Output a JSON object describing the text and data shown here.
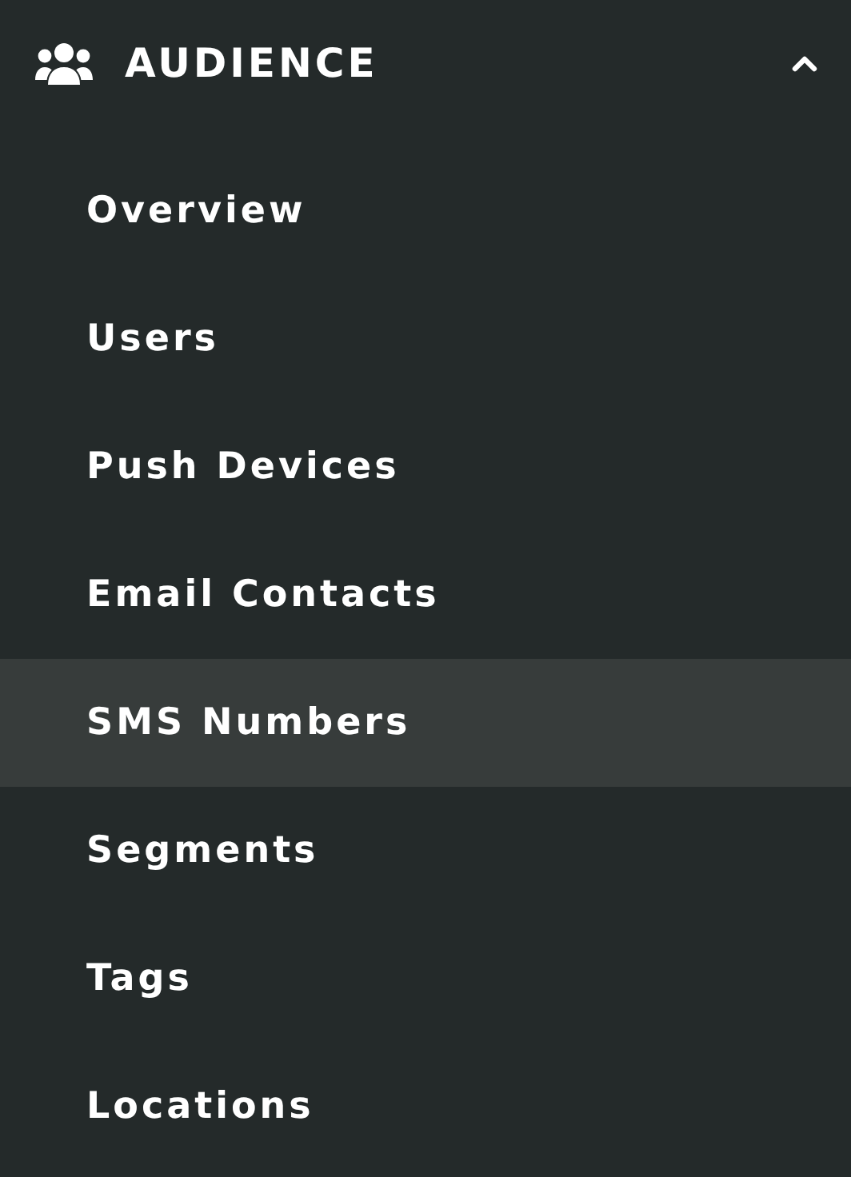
{
  "section": {
    "title": "AUDIENCE",
    "expanded": true
  },
  "items": [
    {
      "label": "Overview",
      "selected": false
    },
    {
      "label": "Users",
      "selected": false
    },
    {
      "label": "Push Devices",
      "selected": false
    },
    {
      "label": "Email Contacts",
      "selected": false
    },
    {
      "label": "SMS Numbers",
      "selected": true
    },
    {
      "label": "Segments",
      "selected": false
    },
    {
      "label": "Tags",
      "selected": false
    },
    {
      "label": "Locations",
      "selected": false
    }
  ]
}
